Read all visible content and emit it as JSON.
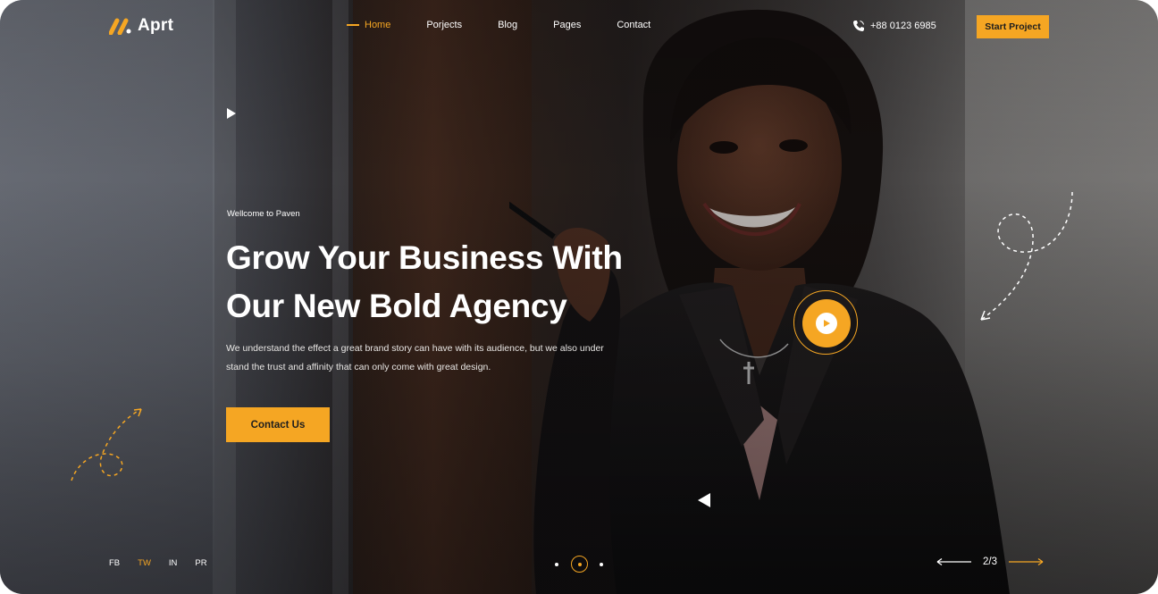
{
  "brand": {
    "name": "Aprt",
    "accent": "#f5a623"
  },
  "nav": {
    "items": [
      {
        "label": "Home",
        "active": true
      },
      {
        "label": "Porjects",
        "active": false
      },
      {
        "label": "Blog",
        "active": false
      },
      {
        "label": "Pages",
        "active": false
      },
      {
        "label": "Contact",
        "active": false
      }
    ],
    "phone": "+88 0123 6985",
    "cta": "Start Project"
  },
  "hero": {
    "eyebrow": "Wellcome to Paven",
    "title_line1": "Grow Your Business With",
    "title_line2": "Our New Bold Agency",
    "description_line1": "We understand the effect a great brand story can have with its audience, but we also under",
    "description_line2": "stand the trust and affinity that can only come with great design.",
    "button": "Contact Us"
  },
  "icons": {
    "logo": "logo-mark-icon",
    "phone": "phone-icon",
    "play_small": "play-icon",
    "video": "play-circle-icon",
    "back": "triangle-left-icon",
    "prev": "arrow-left-icon",
    "next": "arrow-right-icon"
  },
  "socials": [
    {
      "label": "FB",
      "active": false
    },
    {
      "label": "TW",
      "active": true
    },
    {
      "label": "IN",
      "active": false
    },
    {
      "label": "PR",
      "active": false
    }
  ],
  "slider": {
    "dots_count": 3,
    "active_dot": 2,
    "current": "2/3"
  }
}
